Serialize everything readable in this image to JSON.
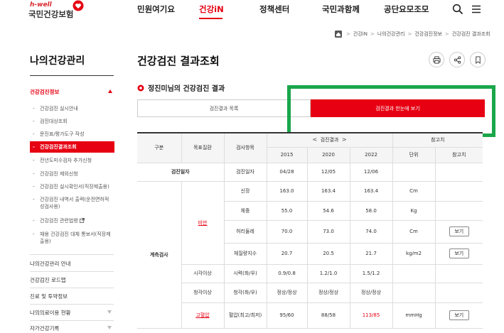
{
  "header": {
    "logo_small": "h-well",
    "logo_main": "국민건강보험",
    "nav": [
      "민원여기요",
      "건강iN",
      "정책센터",
      "국민과함께",
      "공단요모조모"
    ],
    "active_nav_index": 1,
    "accent_color": "#e60012"
  },
  "breadcrumb": [
    "건강iN",
    "나의건강관리",
    "건강검진정보",
    "건강검진 결과조회"
  ],
  "sidebar": {
    "title": "나의건강관리",
    "group": "건강검진정보",
    "sub_items": [
      "건강검진 실시안내",
      "검진대상조회",
      "문진표/평가도구 작성",
      "건강검진결과조회",
      "전년도미수검자 추가신청",
      "건강검진 제외신청",
      "건강검진 실시확인서(직장제출용)",
      "건강검진 내역서 출력(운전면허적성검사용)",
      "건강검진 관련법령",
      "채용 건강검진 대체 통보서(직장제출용)"
    ],
    "main_items": [
      "나의건강관리 안내",
      "건강검진 로드맵",
      "진료 및 투약정보",
      "나의의료이용 현황",
      "자가건강기록"
    ]
  },
  "content": {
    "page_title": "건강검진 결과조회",
    "section_title": "정진미님의 건강검진 결과",
    "tab_list": "검진결과 목록",
    "tab_overview": "검진결과 한눈에 보기"
  },
  "table": {
    "head": {
      "gubun": "구분",
      "disease": "목표질환",
      "item": "검사항목",
      "results": "검진결과",
      "reference": "참고치",
      "unit": "단위",
      "ref_value": "참고치",
      "years": [
        "2015",
        "2020",
        "2022"
      ]
    },
    "date_row": {
      "label": "검진일자",
      "item": "검진일자",
      "values": [
        "04/28",
        "12/05",
        "12/06"
      ]
    },
    "group_label": "계측검사",
    "obesity": "비만",
    "rows": [
      {
        "item": "신장",
        "v1": "163.0",
        "v2": "163.4",
        "v3": "163.4",
        "unit": "Cm",
        "btn": ""
      },
      {
        "item": "체중",
        "v1": "55.0",
        "v2": "54.6",
        "v3": "58.0",
        "unit": "Kg",
        "btn": ""
      },
      {
        "item": "허리둘레",
        "v1": "70.0",
        "v2": "73.0",
        "v3": "74.0",
        "unit": "Cm",
        "btn": "보기"
      },
      {
        "item": "체질량지수",
        "v1": "20.7",
        "v2": "20.5",
        "v3": "21.7",
        "unit": "kg/m2",
        "btn": "보기"
      }
    ],
    "vision": {
      "disease": "시각이상",
      "item": "시력(좌/우)",
      "v1": "0.9/0.8",
      "v2": "1.2/1.0",
      "v3": "1.5/1.2"
    },
    "hearing": {
      "disease": "청각이상",
      "item": "청각(좌/우)",
      "v1": "정상/정상",
      "v2": "정상/정상",
      "v3": "정상/정상"
    },
    "bp": {
      "disease": "고혈압",
      "item": "혈압(최고/최저)",
      "v1": "95/60",
      "v2": "88/58",
      "v3": "113/85",
      "unit": "mmHg",
      "btn": "보기"
    }
  }
}
